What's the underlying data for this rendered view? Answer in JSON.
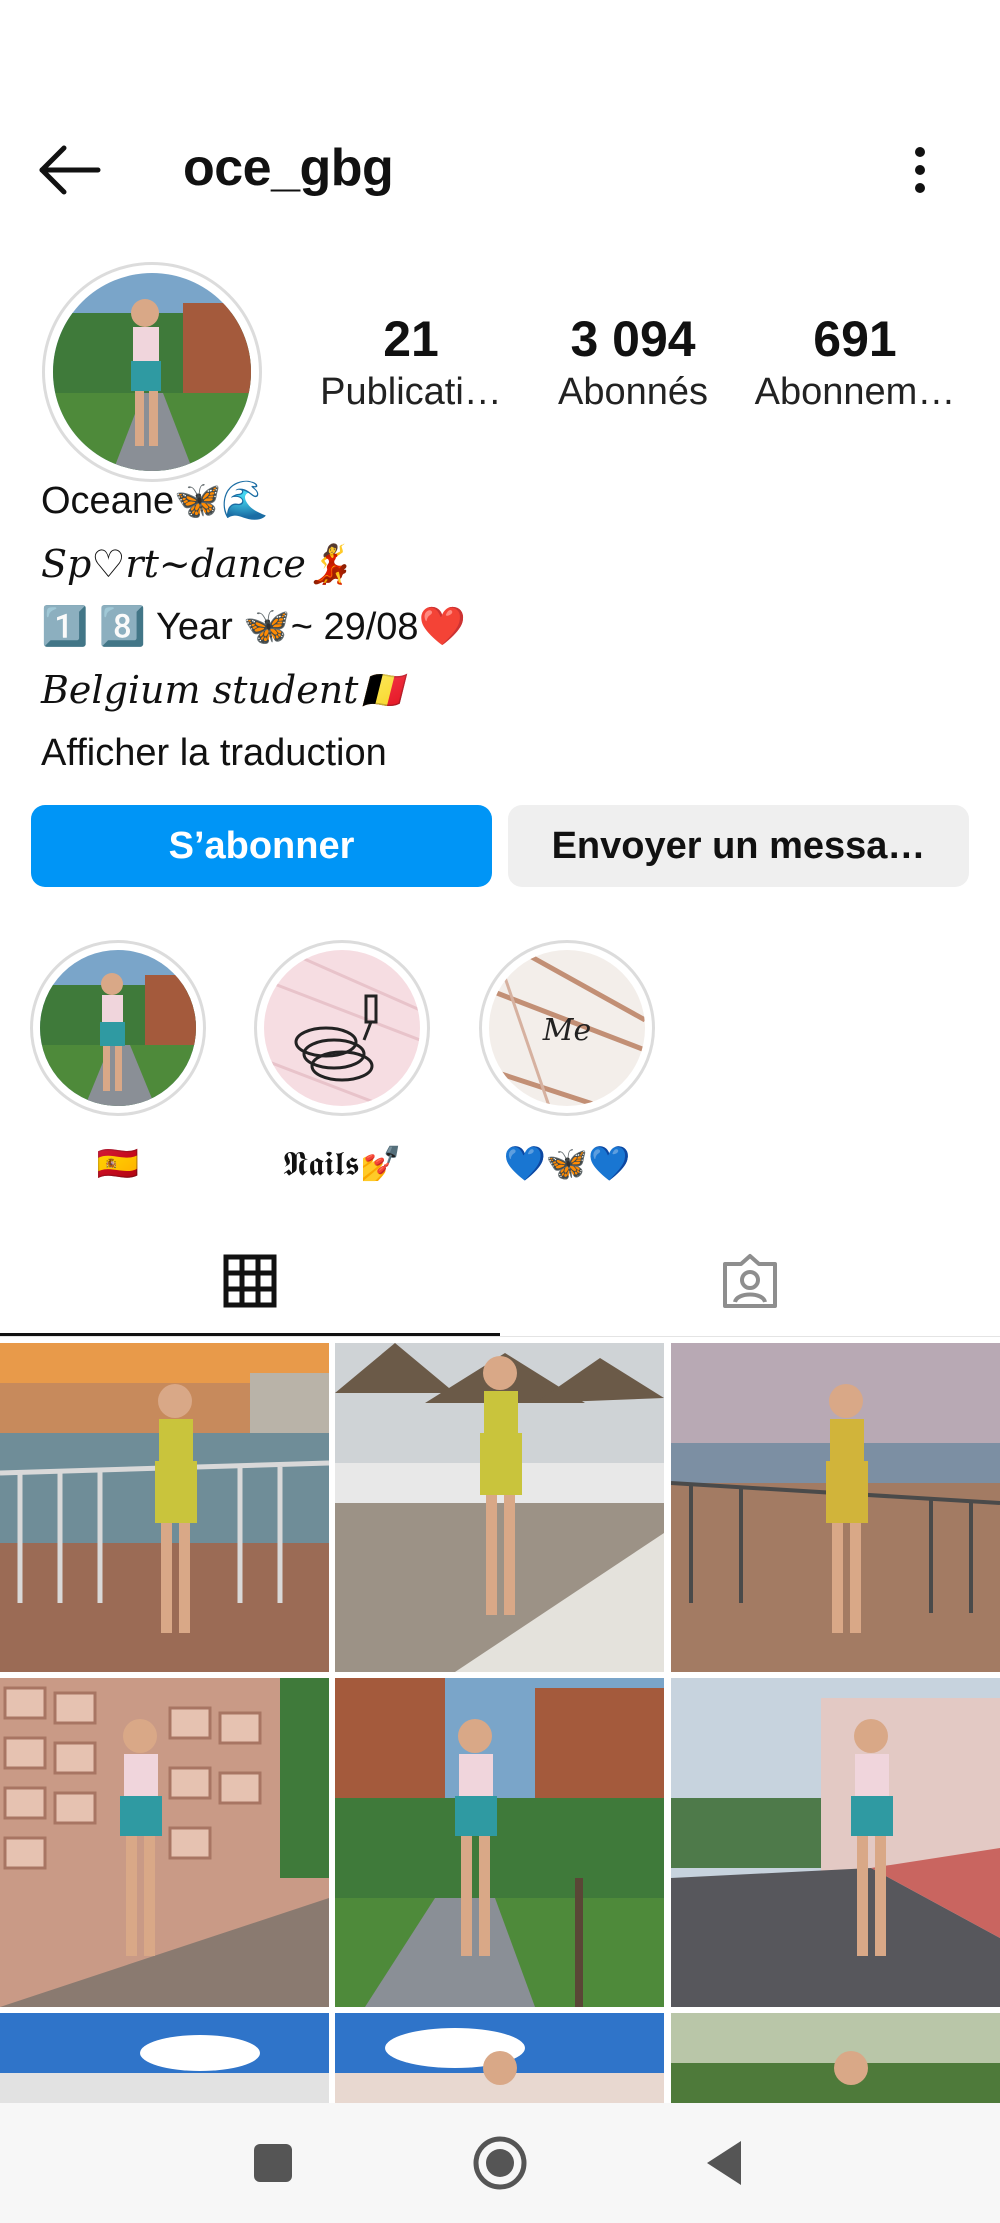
{
  "profile": {
    "username": "oce_gbg",
    "stats": [
      {
        "value": "21",
        "label": "Publicati…"
      },
      {
        "value": "3 094",
        "label": "Abonnés"
      },
      {
        "value": "691",
        "label": "Abonnem…"
      }
    ],
    "bio": {
      "name": "Oceane🦋🌊",
      "line2": "Sp♡rt~dance💃",
      "line3": "1️⃣ 8️⃣ Year 🦋~ 29/08❤️",
      "line4": "Belgium student🇧🇪",
      "translate_link": "Afficher la traduction"
    }
  },
  "actions": {
    "follow_label": "S’abonner",
    "message_label": "Envoyer un messa…"
  },
  "highlights": [
    {
      "label": "🇪🇸",
      "image": "outdoor-photo"
    },
    {
      "label": "𝕹𝖆𝖎𝖑𝖘💅",
      "image": "nail-polish-icon"
    },
    {
      "label": "💙🦋💙",
      "image": "marble-me"
    }
  ],
  "highlight_me_text": "Me",
  "tabs": [
    {
      "icon": "grid-icon",
      "active": true
    },
    {
      "icon": "tagged-person-icon",
      "active": false
    }
  ],
  "colors": {
    "accent": "#0095f6",
    "secondary_button": "#efefef"
  },
  "grid_posts": [
    {
      "scene": "sunset-railing-yellow-outfit"
    },
    {
      "scene": "beach-umbrellas-yellow-outfit"
    },
    {
      "scene": "seaside-railing-yellow-outfit"
    },
    {
      "scene": "stone-wall-leaf-shorts"
    },
    {
      "scene": "garden-path-leaf-shorts"
    },
    {
      "scene": "street-leaf-shorts"
    },
    {
      "scene": "blue-sky-town"
    },
    {
      "scene": "blue-sky-town-2"
    },
    {
      "scene": "villas-sign"
    }
  ]
}
